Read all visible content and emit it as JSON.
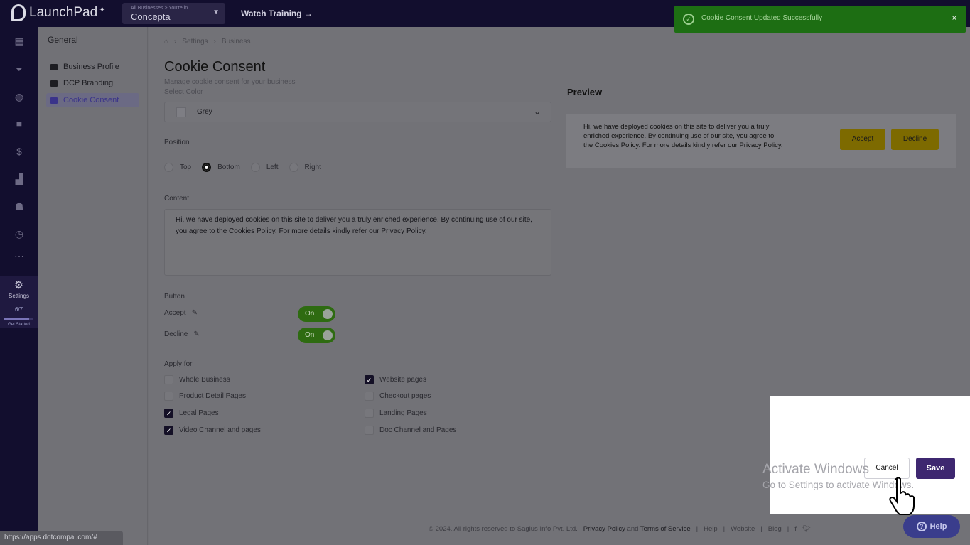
{
  "topbar": {
    "app_name": "LaunchPad",
    "business_switcher_caption": "All Businesses > You're in",
    "business_name": "Concepta",
    "watch_training": "Watch Training →"
  },
  "rail": {
    "settings_label": "Settings",
    "progress_text": "6/7",
    "progress_fraction": 0.86,
    "get_started": "Get Started"
  },
  "subnav": {
    "heading": "General",
    "items": [
      {
        "label": "Business Profile",
        "icon": "business-card-icon"
      },
      {
        "label": "DCP Branding",
        "icon": "branding-icon"
      },
      {
        "label": "Cookie Consent",
        "icon": "cookie-icon"
      }
    ]
  },
  "breadcrumb": {
    "home": "⌂",
    "settings": "Settings",
    "business": "Business"
  },
  "page": {
    "title": "Cookie Consent",
    "subtitle": "Manage cookie consent for your business",
    "select_color_label": "Select Color",
    "color_value": "Grey",
    "position_label": "Position",
    "positions": [
      "Top",
      "Bottom",
      "Left",
      "Right"
    ],
    "selected_position": "Bottom",
    "content_label": "Content",
    "content_text": "Hi, we have deployed cookies on this site to deliver you a truly enriched experience. By continuing use of our site, you agree to the Cookies Policy. For more details kindly refer our Privacy Policy.",
    "button_label": "Button",
    "accept_label": "Accept",
    "decline_label": "Decline",
    "toggle_on": "On",
    "apply_for_label": "Apply for",
    "apply_options": [
      {
        "label": "Whole Business",
        "checked": false
      },
      {
        "label": "Product Detail Pages",
        "checked": false
      },
      {
        "label": "Legal Pages",
        "checked": true
      },
      {
        "label": "Video Channel and pages",
        "checked": true
      },
      {
        "label": "Website pages",
        "checked": true
      },
      {
        "label": "Checkout pages",
        "checked": false
      },
      {
        "label": "Landing Pages",
        "checked": false
      },
      {
        "label": "Doc Channel and Pages",
        "checked": false
      }
    ]
  },
  "preview": {
    "title": "Preview",
    "text": "Hi, we have deployed cookies on this site to deliver you a truly enriched experience. By continuing use of our site, you agree to the Cookies Policy. For more details kindly refer our Privacy Policy.",
    "accept": "Accept",
    "decline": "Decline"
  },
  "toast": {
    "message": "Cookie Consent Updated Successfully",
    "close": "×"
  },
  "actions": {
    "cancel": "Cancel",
    "save": "Save"
  },
  "watermark": {
    "line1": "Activate Windows",
    "line2": "Go to Settings to activate Windows."
  },
  "footer": {
    "copyright": "© 2024. All rights reserved to Saglus Info Pvt. Ltd.",
    "privacy": "Privacy Policy",
    "and": "and",
    "terms": "Terms of Service",
    "help": "Help",
    "website": "Website",
    "blog": "Blog",
    "sep": "|"
  },
  "help_button": "Help",
  "status_url": "https://apps.dotcompal.com/#",
  "colors": {
    "toast_green": "#1d6e13",
    "toggle_green": "#2e6b11",
    "save_purple": "#3e2770",
    "preview_yellow": "#7d6a00"
  }
}
